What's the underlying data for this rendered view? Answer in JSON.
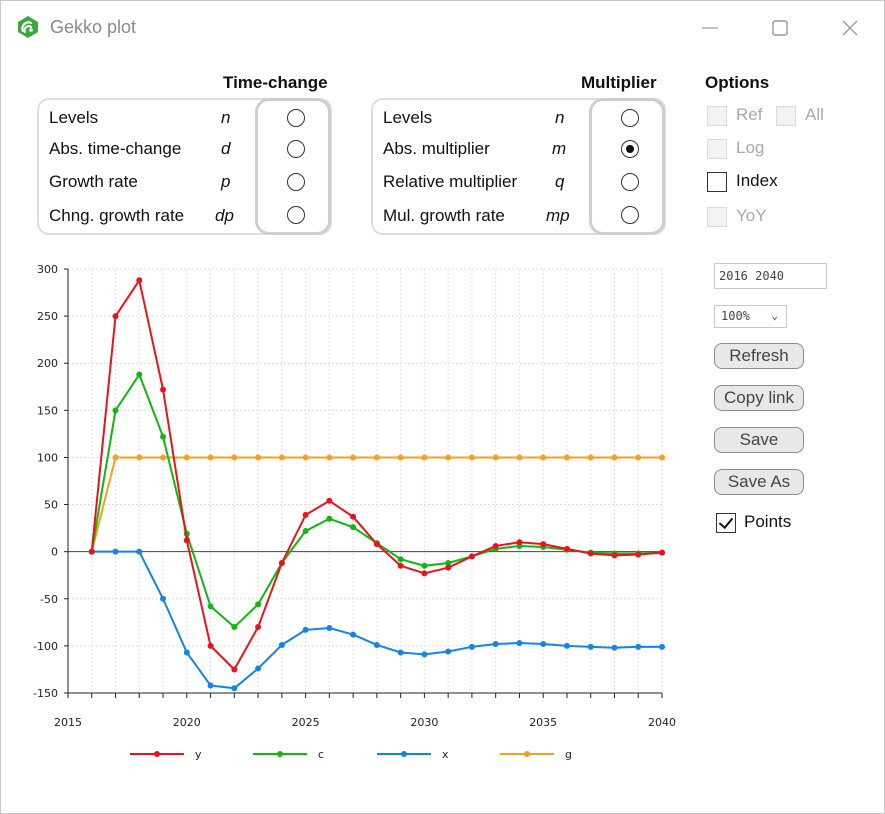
{
  "window": {
    "title": "Gekko plot"
  },
  "time_change": {
    "title": "Time-change",
    "rows": [
      {
        "label": "Levels",
        "code": "n",
        "selected": false
      },
      {
        "label": "Abs. time-change",
        "code": "d",
        "selected": false
      },
      {
        "label": "Growth rate",
        "code": "p",
        "selected": false
      },
      {
        "label": "Chng. growth rate",
        "code": "dp",
        "selected": false
      }
    ]
  },
  "multiplier": {
    "title": "Multiplier",
    "rows": [
      {
        "label": "Levels",
        "code": "n",
        "selected": false
      },
      {
        "label": "Abs. multiplier",
        "code": "m",
        "selected": true
      },
      {
        "label": "Relative multiplier",
        "code": "q",
        "selected": false
      },
      {
        "label": "Mul. growth rate",
        "code": "mp",
        "selected": false
      }
    ]
  },
  "options": {
    "title": "Options",
    "ref": {
      "label": "Ref",
      "checked": false,
      "enabled": false
    },
    "all": {
      "label": "All",
      "checked": false,
      "enabled": false
    },
    "log": {
      "label": "Log",
      "checked": false,
      "enabled": false
    },
    "index": {
      "label": "Index",
      "checked": false,
      "enabled": true
    },
    "yoy": {
      "label": "YoY",
      "checked": false,
      "enabled": false
    },
    "points": {
      "label": "Points",
      "checked": true,
      "enabled": true
    }
  },
  "controls": {
    "period": "2016 2040",
    "zoom": "100%",
    "refresh": "Refresh",
    "copy_link": "Copy link",
    "save": "Save",
    "save_as": "Save As"
  },
  "chart_data": {
    "type": "line",
    "title": "",
    "xlabel": "",
    "ylabel": "",
    "x": [
      2016,
      2017,
      2018,
      2019,
      2020,
      2021,
      2022,
      2023,
      2024,
      2025,
      2026,
      2027,
      2028,
      2029,
      2030,
      2031,
      2032,
      2033,
      2034,
      2035,
      2036,
      2037,
      2038,
      2039,
      2040
    ],
    "xlim": [
      2015,
      2040
    ],
    "ylim": [
      -150,
      300
    ],
    "xticks": [
      2015,
      2020,
      2025,
      2030,
      2035,
      2040
    ],
    "yticks": [
      -150,
      -100,
      -50,
      0,
      50,
      100,
      150,
      200,
      250,
      300
    ],
    "grid": true,
    "legend": "bottom",
    "series": [
      {
        "name": "y",
        "color": "#e8141c",
        "values": [
          0,
          250,
          288,
          172,
          12,
          -100,
          -125,
          -80,
          -12,
          39,
          54,
          37,
          8,
          -15,
          -23,
          -17,
          -5,
          6,
          10,
          8,
          3,
          -2,
          -4,
          -3,
          -1
        ]
      },
      {
        "name": "c",
        "color": "#11b611",
        "values": [
          0,
          150,
          188,
          122,
          19,
          -58,
          -80,
          -56,
          -12,
          22,
          35,
          26,
          9,
          -8,
          -15,
          -12,
          -5,
          3,
          6,
          5,
          2,
          -1,
          -2,
          -2,
          -1
        ]
      },
      {
        "name": "x",
        "color": "#1484e6",
        "values": [
          0,
          0,
          0,
          -50,
          -107,
          -142,
          -145,
          -124,
          -99,
          -83,
          -81,
          -88,
          -99,
          -107,
          -109,
          -106,
          -101,
          -98,
          -97,
          -98,
          -100,
          -101,
          -102,
          -101,
          -101
        ]
      },
      {
        "name": "g",
        "color": "#f3a11c",
        "values": [
          0,
          100,
          100,
          100,
          100,
          100,
          100,
          100,
          100,
          100,
          100,
          100,
          100,
          100,
          100,
          100,
          100,
          100,
          100,
          100,
          100,
          100,
          100,
          100,
          100
        ]
      }
    ]
  }
}
